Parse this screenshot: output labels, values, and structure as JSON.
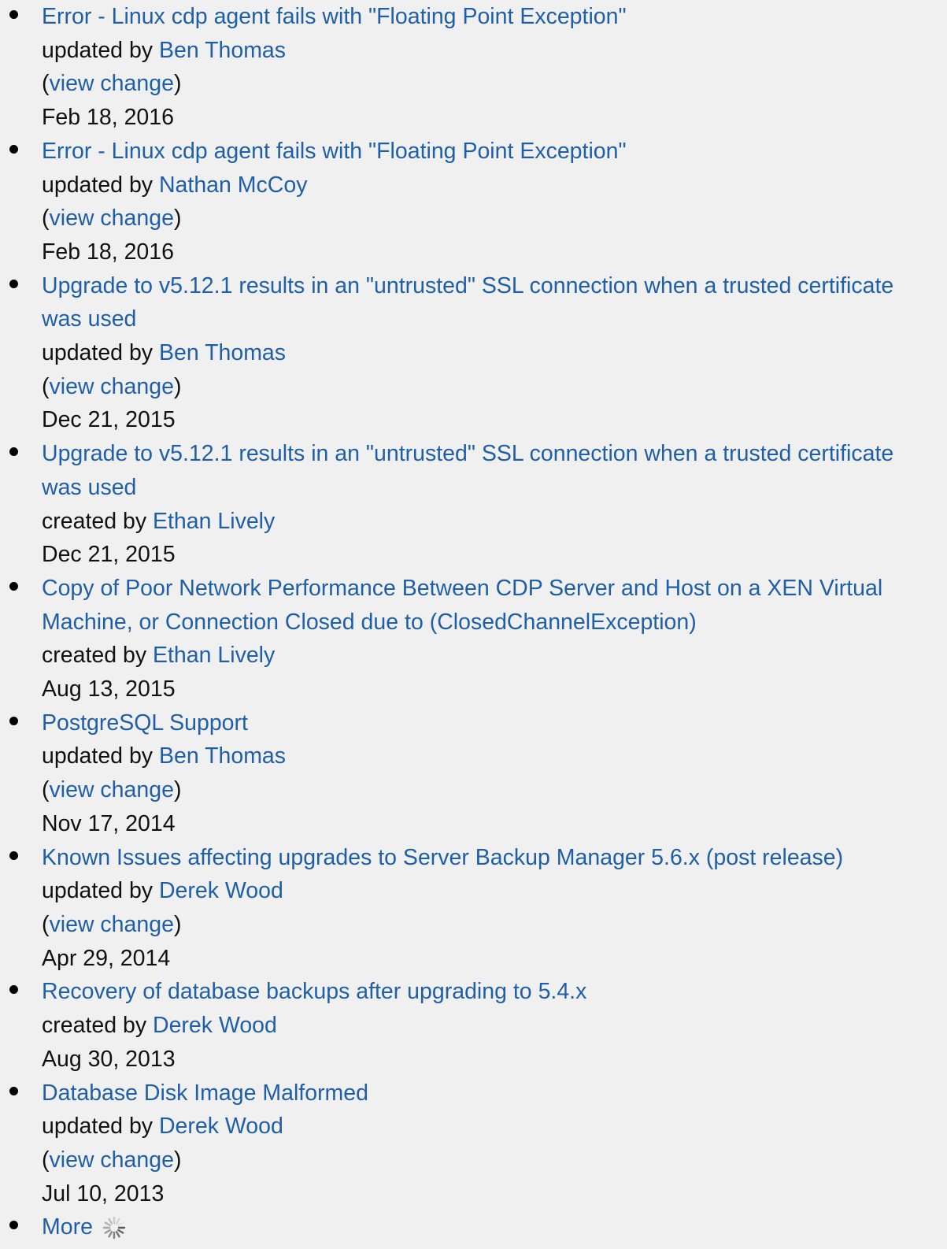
{
  "colors": {
    "link": "#1f5fa8",
    "text": "#111111",
    "background": "#f0f0f0"
  },
  "labels": {
    "view_change": "view change",
    "open_paren": "(",
    "close_paren": ")"
  },
  "items": [
    {
      "title": "Error - Linux cdp agent fails with \"Floating Point Exception\"",
      "action": "updated by ",
      "author": "Ben Thomas",
      "has_view_change": true,
      "date": "Feb 18, 2016"
    },
    {
      "title": "Error - Linux cdp agent fails with \"Floating Point Exception\"",
      "action": "updated by ",
      "author": "Nathan McCoy",
      "has_view_change": true,
      "date": "Feb 18, 2016"
    },
    {
      "title": "Upgrade to v5.12.1 results in an \"untrusted\" SSL connection when a trusted certificate was used",
      "action": "updated by ",
      "author": "Ben Thomas",
      "has_view_change": true,
      "date": "Dec 21, 2015"
    },
    {
      "title": "Upgrade to v5.12.1 results in an \"untrusted\" SSL connection when a trusted certificate was used",
      "action": "created by ",
      "author": "Ethan Lively",
      "has_view_change": false,
      "date": "Dec 21, 2015"
    },
    {
      "title": "Copy of Poor Network Performance Between CDP Server and Host on a XEN Virtual Machine, or Connection Closed due to (ClosedChannelException)",
      "action": "created by ",
      "author": "Ethan Lively",
      "has_view_change": false,
      "date": "Aug 13, 2015"
    },
    {
      "title": "PostgreSQL Support",
      "action": "updated by ",
      "author": "Ben Thomas",
      "has_view_change": true,
      "date": "Nov 17, 2014"
    },
    {
      "title": "Known Issues affecting upgrades to Server Backup Manager 5.6.x (post release)",
      "action": "updated by ",
      "author": "Derek Wood",
      "has_view_change": true,
      "date": "Apr 29, 2014"
    },
    {
      "title": "Recovery of database backups after upgrading to 5.4.x",
      "action": "created by ",
      "author": "Derek Wood",
      "has_view_change": false,
      "date": "Aug 30, 2013"
    },
    {
      "title": "Database Disk Image Malformed",
      "action": "updated by ",
      "author": "Derek Wood",
      "has_view_change": true,
      "date": "Jul 10, 2013"
    }
  ],
  "more": {
    "label": "More",
    "icon": "loading-spinner-icon"
  }
}
